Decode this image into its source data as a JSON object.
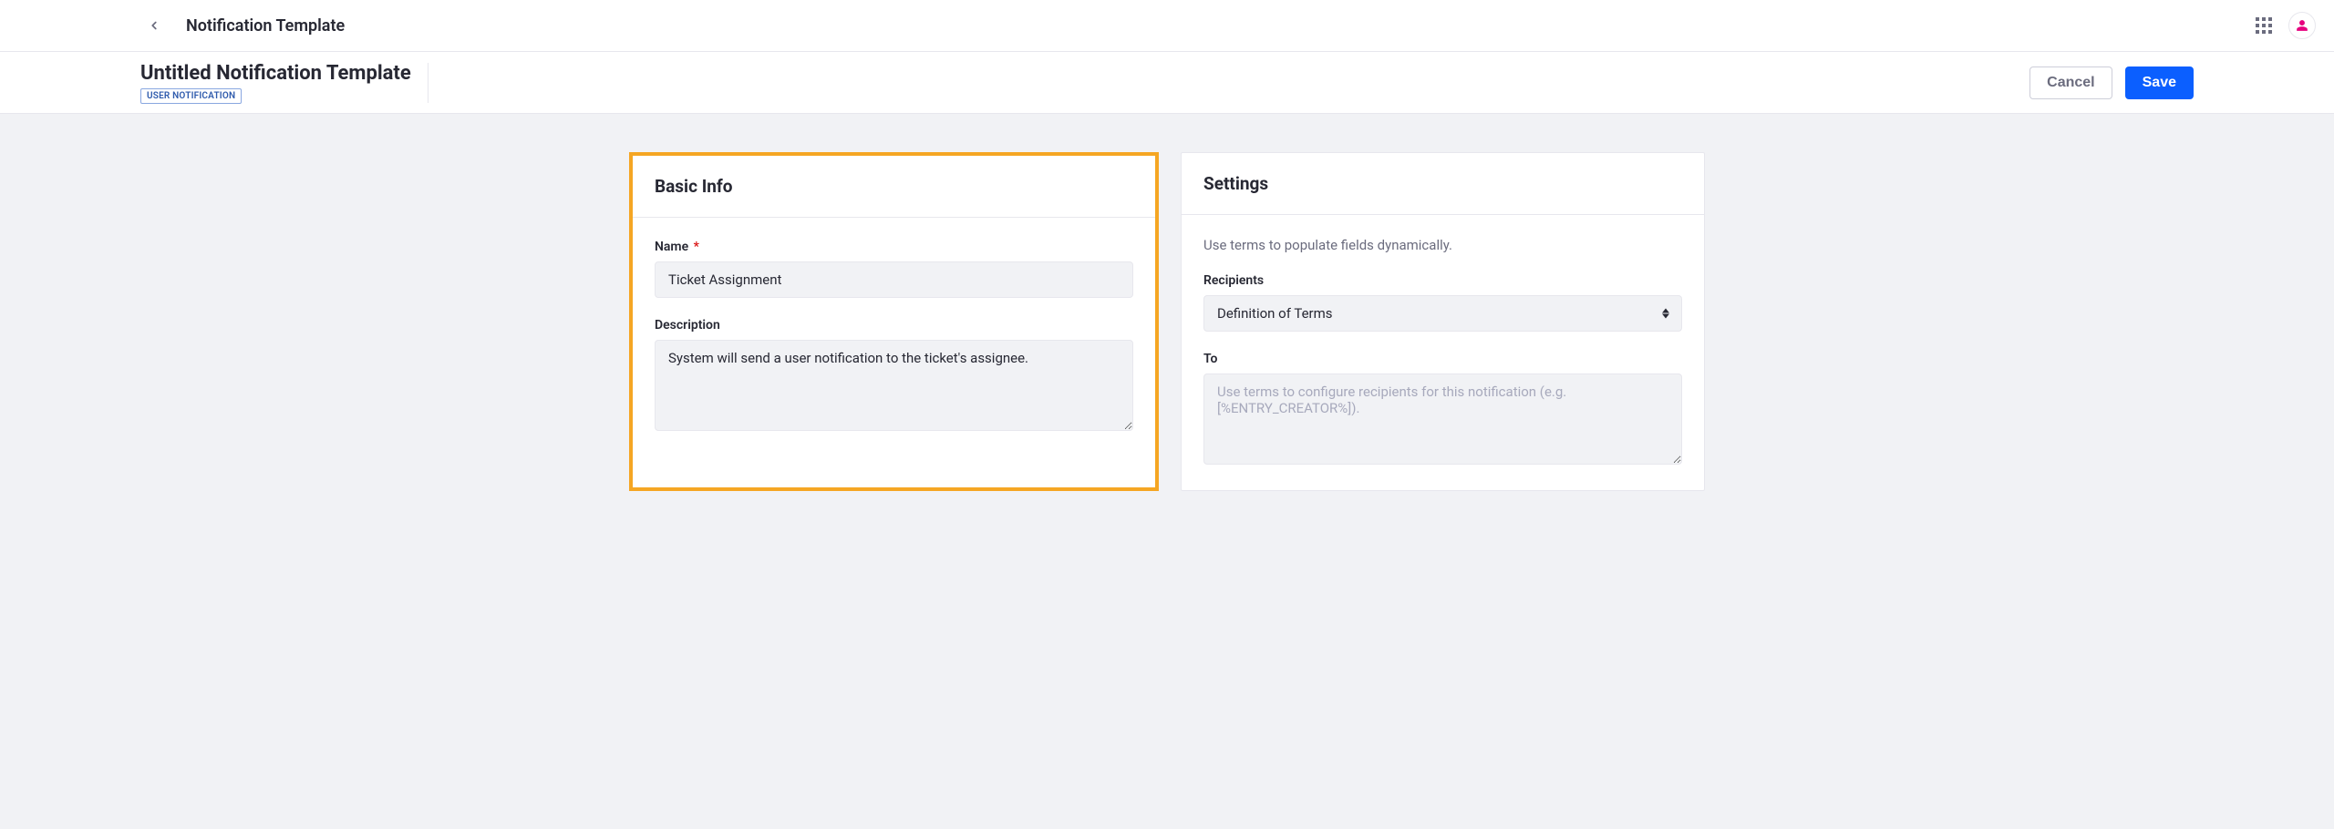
{
  "topbar": {
    "breadcrumb_title": "Notification Template"
  },
  "subheader": {
    "page_title": "Untitled Notification Template",
    "badge": "USER NOTIFICATION",
    "cancel_label": "Cancel",
    "save_label": "Save"
  },
  "basic_info": {
    "card_title": "Basic Info",
    "name_label": "Name",
    "name_value": "Ticket Assignment",
    "description_label": "Description",
    "description_value": "System will send a user notification to the ticket's assignee."
  },
  "settings": {
    "card_title": "Settings",
    "hint": "Use terms to populate fields dynamically.",
    "recipients_label": "Recipients",
    "recipients_select_value": "Definition of Terms",
    "to_label": "To",
    "to_placeholder": "Use terms to configure recipients for this notification (e.g. [%ENTRY_CREATOR%]).",
    "to_value": ""
  }
}
